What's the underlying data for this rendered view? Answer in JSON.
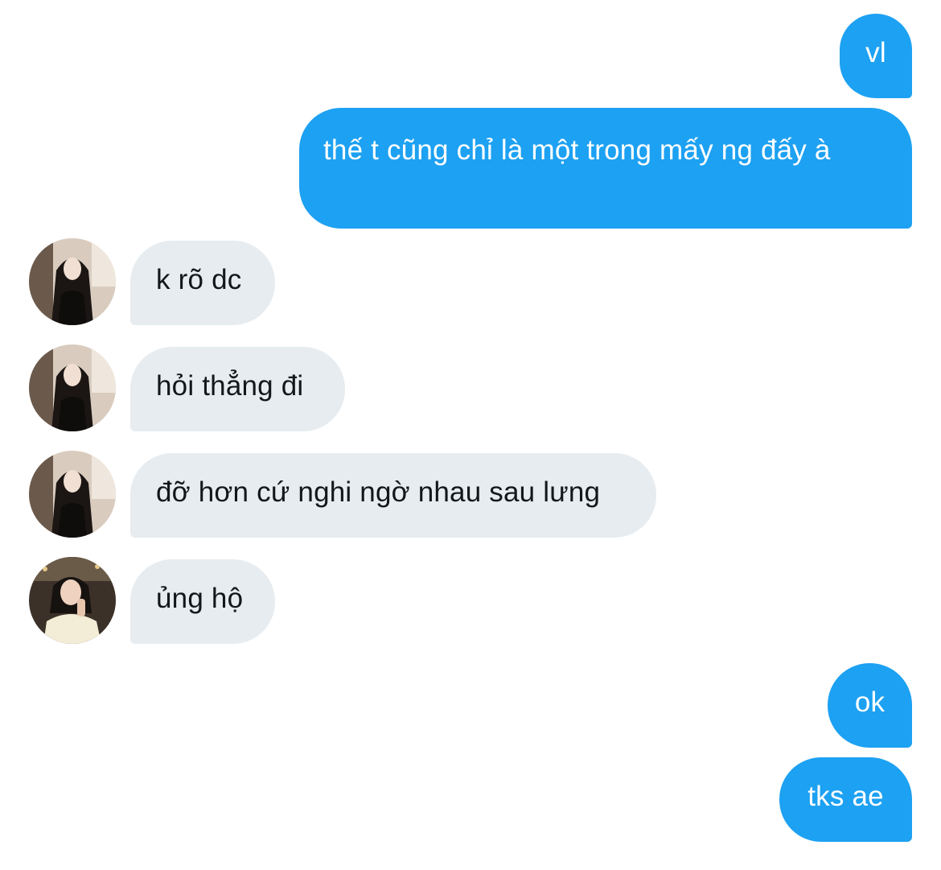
{
  "conversation": {
    "messages": [
      {
        "direction": "sent",
        "text": "vl"
      },
      {
        "direction": "sent",
        "text": "thế t cũng chỉ là một trong mấy ng đấy à"
      },
      {
        "direction": "received",
        "sender_avatar": "avatar-a",
        "text": "k rõ dc"
      },
      {
        "direction": "received",
        "sender_avatar": "avatar-a",
        "text": "hỏi thẳng đi"
      },
      {
        "direction": "received",
        "sender_avatar": "avatar-a",
        "text": "đỡ hơn cứ nghi ngờ nhau sau lưng"
      },
      {
        "direction": "received",
        "sender_avatar": "avatar-b",
        "text": "ủng hộ"
      },
      {
        "direction": "sent",
        "text": "ok"
      },
      {
        "direction": "sent",
        "text": "tks ae"
      }
    ]
  },
  "colors": {
    "sent_bubble": "#1da1f2",
    "sent_text": "#ffffff",
    "received_bubble": "#e6ecf0",
    "received_text": "#14171a",
    "background": "#ffffff"
  }
}
